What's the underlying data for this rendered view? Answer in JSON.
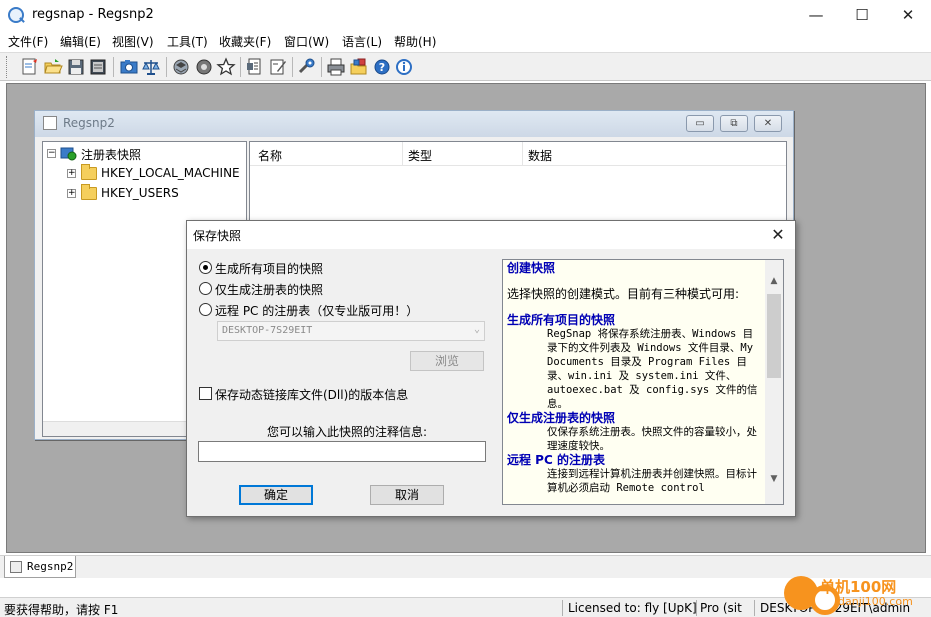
{
  "window": {
    "title": "regsnap - Regsnp2",
    "controls": [
      "—",
      "☐",
      "✕"
    ]
  },
  "menu": [
    "文件(F)",
    "编辑(E)",
    "视图(V)",
    "工具(T)",
    "收藏夹(F)",
    "窗口(W)",
    "语言(L)",
    "帮助(H)"
  ],
  "toolbar": {
    "buttons": [
      "new-snapshot-icon",
      "open-icon",
      "save-icon",
      "save-all-icon",
      "snapshot-camera-icon",
      "compare-scales-icon",
      "network-icon",
      "registry-icon",
      "star-icon",
      "report-icon",
      "edit-icon",
      "tools-icon",
      "print-icon",
      "folder-puzzle-icon",
      "help-icon",
      "about-icon"
    ]
  },
  "child_window": {
    "title": "Regsnp2",
    "controls": [
      "▭",
      "⧉",
      "✕"
    ]
  },
  "tree": {
    "root": "注册表快照",
    "expander_collapsed": "−",
    "expander_expanded": "+",
    "items": [
      {
        "label": "HKEY_LOCAL_MACHINE"
      },
      {
        "label": "HKEY_USERS"
      }
    ]
  },
  "list": {
    "columns": [
      "名称",
      "类型",
      "数据"
    ]
  },
  "dialog": {
    "title": "保存快照",
    "close": "✕",
    "radios": [
      {
        "label": "生成所有项目的快照",
        "checked": true
      },
      {
        "label": "仅生成注册表的快照",
        "checked": false
      },
      {
        "label": "远程 PC 的注册表（仅专业版可用！）",
        "checked": false
      }
    ],
    "computer_combo": "DESKTOP-7S29EIT",
    "combo_arrow": "⌄",
    "browse_button": "浏览",
    "dll_checkbox": "保存动态链接库文件(Dll)的版本信息",
    "note_label": "您可以输入此快照的注释信息:",
    "note_value": "",
    "ok_button": "确定",
    "cancel_button": "取消",
    "help": {
      "heading1": "创建快照",
      "intro": "选择快照的创建模式。目前有三种模式可用:",
      "heading2": "生成所有项目的快照",
      "text2": "RegSnap 将保存系统注册表、Windows 目录下的文件列表及 Windows 文件目录、My Documents 目录及 Program Files 目录、win.ini 及 system.ini 文件、autoexec.bat 及 config.sys 文件的信息。",
      "heading3": "仅生成注册表的快照",
      "text3": "仅保存系统注册表。快照文件的容量较小，处理速度较快。",
      "heading4": "远程 PC 的注册表",
      "text4": "连接到远程计算机注册表并创建快照。目标计算机必须启动 Remote control",
      "scroll_up": "▲",
      "scroll_down": "▼"
    }
  },
  "tab": {
    "label": "Regsnp2"
  },
  "status": {
    "help": "要获得帮助，请按 F1",
    "license": "Licensed to: fly [UpK]",
    "edition": "Pro (sit",
    "machine": "DESKTOP-7S29EIT\\admin"
  },
  "watermark": {
    "text": "单机100网",
    "sub": "danji100.com"
  },
  "colors": {
    "help_heading": "#0000b4",
    "help_background": "#fffff2",
    "mdi_background": "#a9a9a9",
    "default_button_border": "#0078d7",
    "watermark": "#f7931e"
  }
}
